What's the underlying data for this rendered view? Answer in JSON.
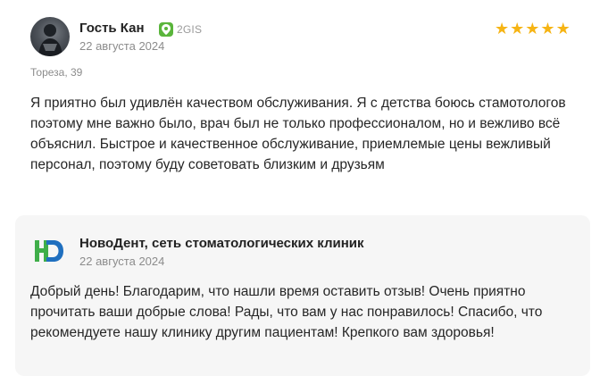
{
  "review": {
    "author": "Гость Кан",
    "source": "2GIS",
    "date": "22 августа 2024",
    "rating": 5,
    "address": "Тореза, 39",
    "text": "Я приятно был удивлён качеством обслуживания. Я с детства боюсь стамотологов поэтому мне важно было, врач был не только профессионалом, но и вежливо всё объяснил. Быстрое и качественное обслуживание, приемлемые цены вежливый персонал, поэтому буду советовать близким и друзьям"
  },
  "reply": {
    "author": "НовоДент, сеть стоматологических клиник",
    "date": "22 августа 2024",
    "text": "Добрый день! Благодарим, что нашли время оставить отзыв! Очень приятно прочитать ваши добрые слова! Рады, что вам у нас понравилось! Спасибо, что рекомендуете нашу клинику другим пациентам! Крепкого вам здоровья!"
  },
  "colors": {
    "star": "#f6b414",
    "source_badge": "#5ab53b",
    "reply_bg": "#f6f6f6",
    "logo_green": "#3fae49",
    "logo_blue": "#1f6fbf"
  },
  "icons": {
    "source": "2gis-pin-icon",
    "rating": "star-icon",
    "reply_logo": "novodent-logo"
  }
}
